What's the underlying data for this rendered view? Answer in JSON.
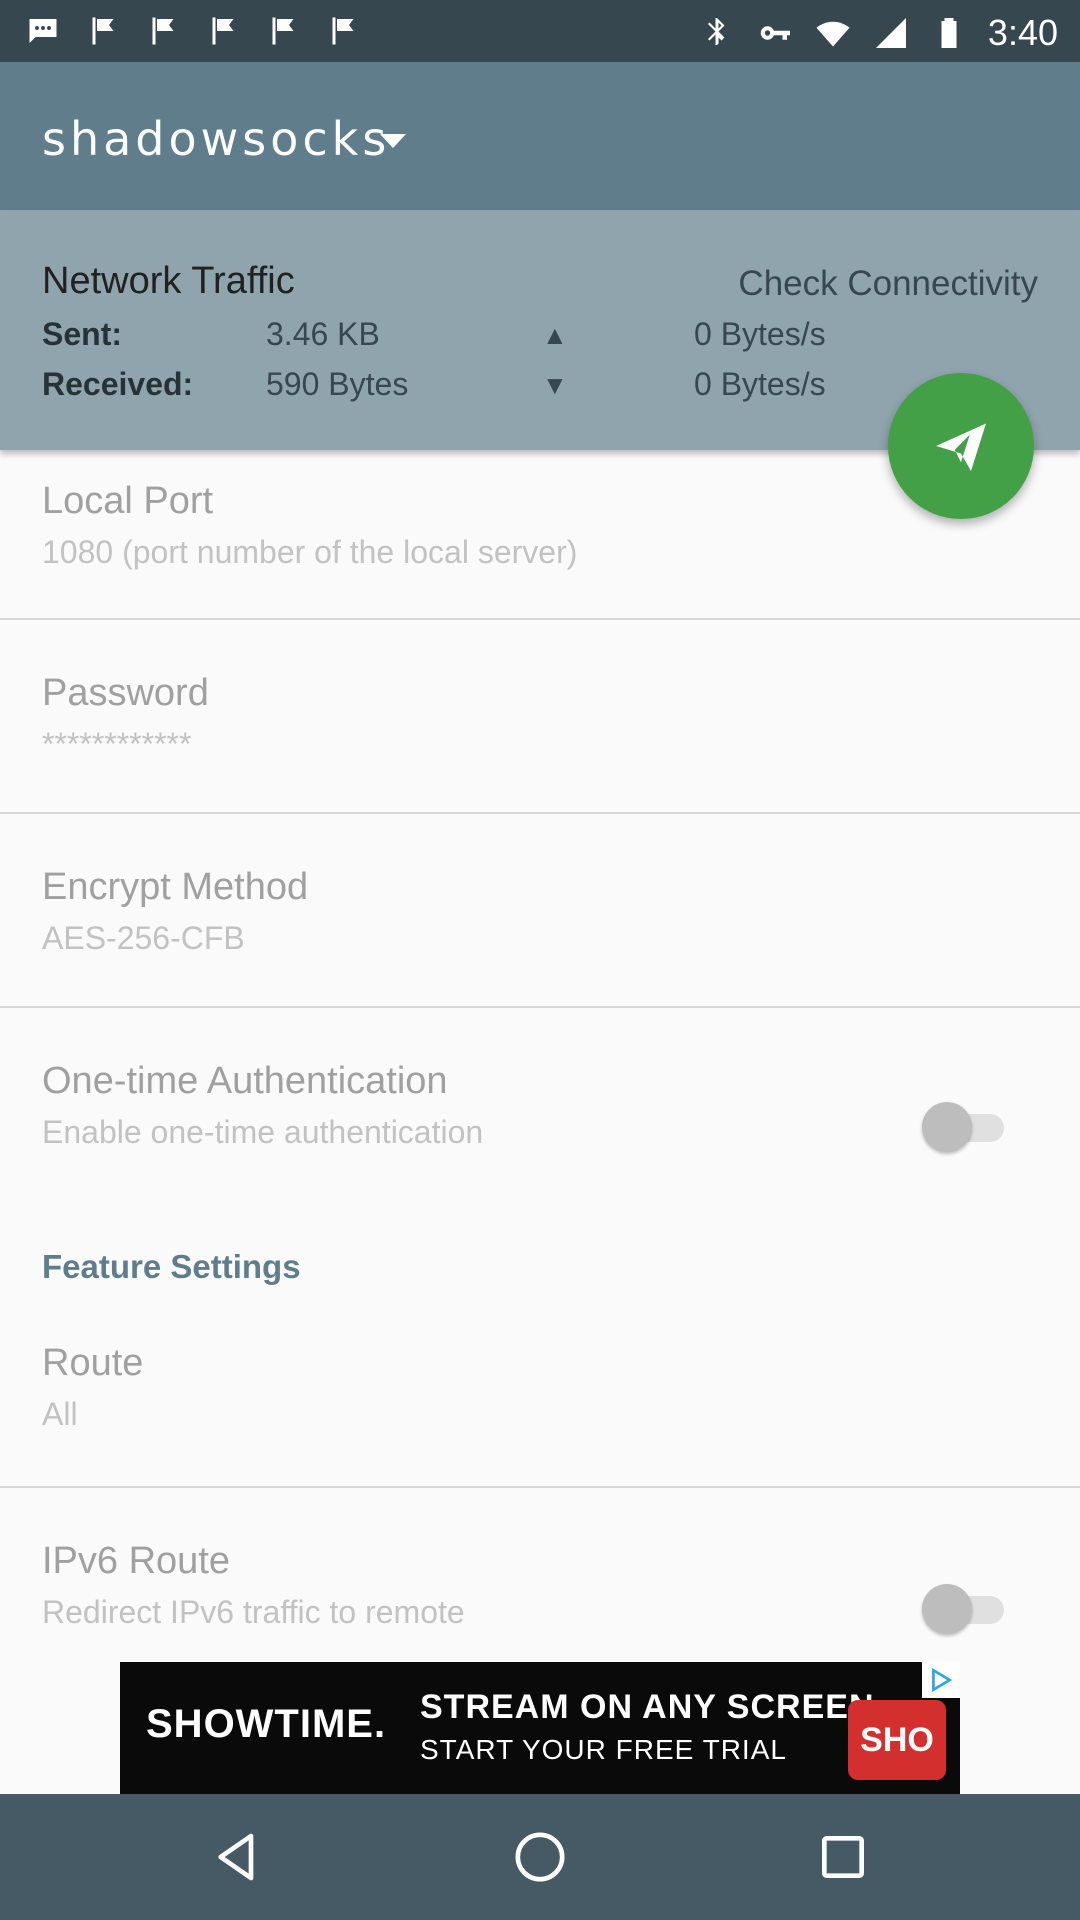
{
  "status_bar": {
    "time": "3:40",
    "left_icons": [
      "message-icon",
      "flag-icon",
      "flag-icon",
      "flag-icon",
      "flag-icon",
      "flag-icon"
    ],
    "right_icons": [
      "bluetooth-icon",
      "key-icon",
      "wifi-icon",
      "signal-icon",
      "battery-icon"
    ]
  },
  "app_bar": {
    "profile_name": "shadowsocks"
  },
  "traffic": {
    "title": "Network Traffic",
    "check_label": "Check Connectivity",
    "sent_label": "Sent:",
    "sent_value": "3.46 KB",
    "sent_rate": "0 Bytes/s",
    "received_label": "Received:",
    "received_value": "590 Bytes",
    "received_rate": "0 Bytes/s",
    "up_arrow": "▲",
    "down_arrow": "▼"
  },
  "fab": {
    "icon": "send-icon",
    "color": "#43a047"
  },
  "preferences": {
    "local_port": {
      "title": "Local Port",
      "summary": "1080 (port number of the local server)"
    },
    "password": {
      "title": "Password",
      "summary": "************"
    },
    "encrypt_method": {
      "title": "Encrypt Method",
      "summary": "AES-256-CFB"
    },
    "one_time_auth": {
      "title": "One-time Authentication",
      "summary": "Enable one-time authentication",
      "enabled": false
    },
    "section_header": "Feature Settings",
    "route": {
      "title": "Route",
      "summary": "All"
    },
    "ipv6_route": {
      "title": "IPv6 Route",
      "summary": "Redirect IPv6 traffic to remote",
      "enabled": false
    }
  },
  "ad": {
    "brand": "SHOWTIME.",
    "line1": "STREAM ON ANY SCREEN",
    "line2": "START YOUR FREE TRIAL",
    "badge": "SHO"
  },
  "nav_bar": {
    "buttons": [
      "back-icon",
      "home-icon",
      "recents-icon"
    ]
  },
  "colors": {
    "status_bar": "#37474f",
    "app_bar": "#607d8b",
    "traffic_panel": "#90a4ae",
    "accent": "#607d8b",
    "nav_bar": "#455a64"
  }
}
